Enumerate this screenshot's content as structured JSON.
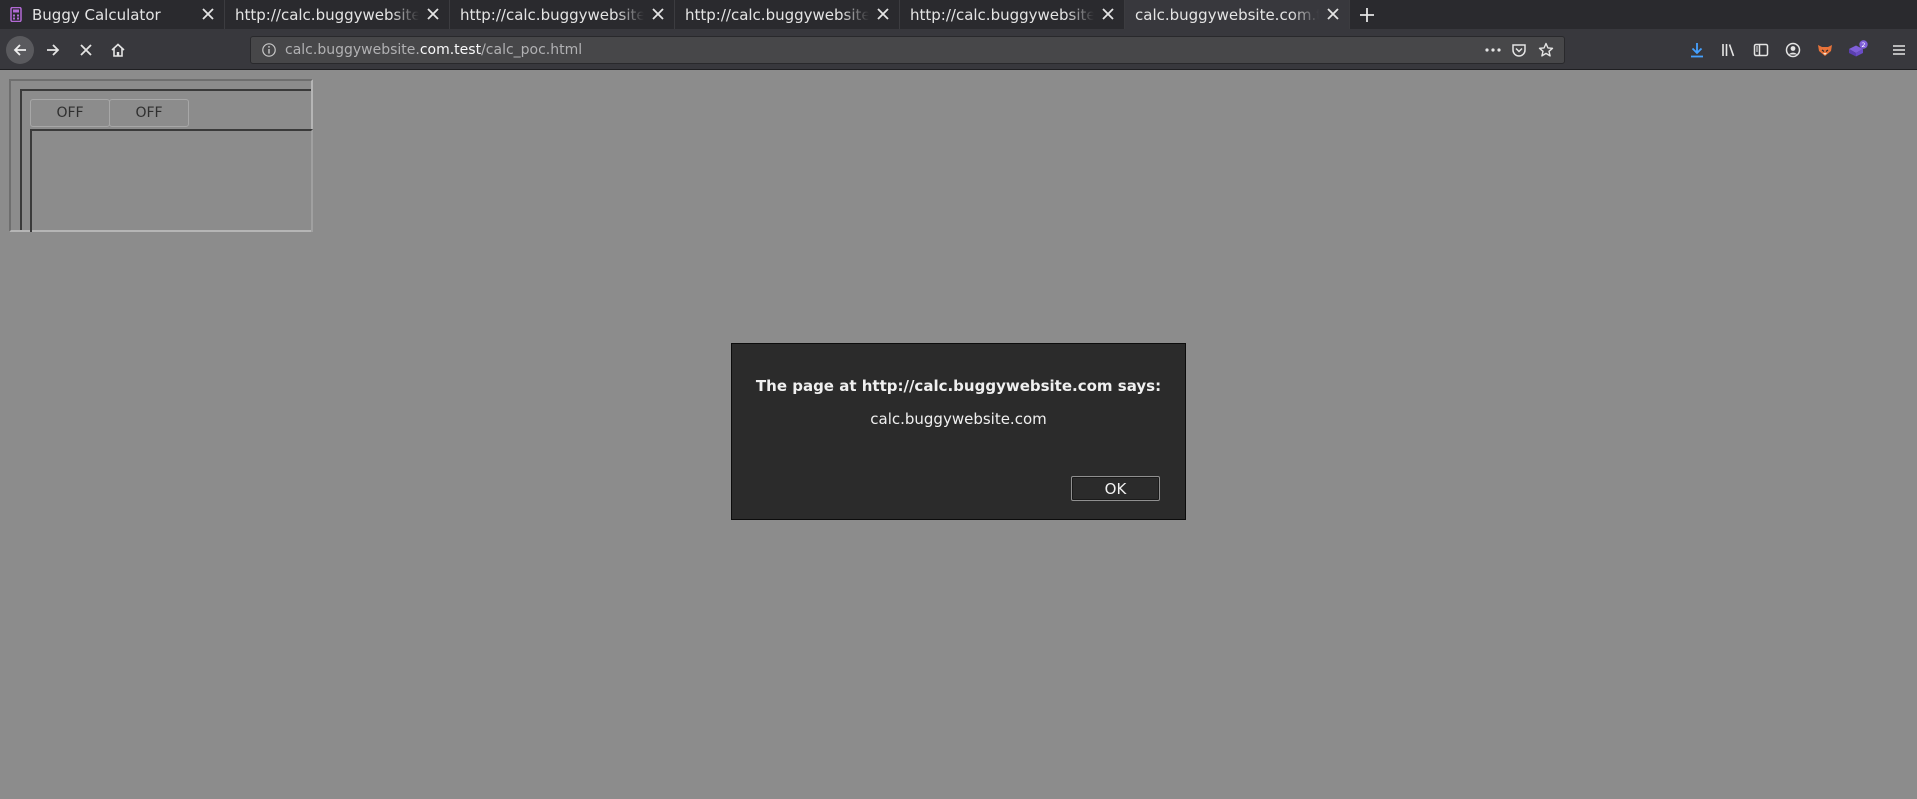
{
  "browser": {
    "tabs": [
      {
        "title": "Buggy Calculator",
        "active": false
      },
      {
        "title": "http://calc.buggywebsite.com",
        "active": false
      },
      {
        "title": "http://calc.buggywebsite.com",
        "active": false
      },
      {
        "title": "http://calc.buggywebsite.com",
        "active": false
      },
      {
        "title": "http://calc.buggywebsite.com",
        "active": false
      },
      {
        "title": "calc.buggywebsite.com.test/calc_poc.html",
        "active": true
      }
    ],
    "url": {
      "prefix": "calc.buggywebsite.",
      "domain": "com.test",
      "path": "/calc_poc.html"
    },
    "extension_badge": "2",
    "colors": {
      "tab_bar": "#2a2a2e",
      "toolbar": "#38383d",
      "urlbar": "#474749",
      "download_accent": "#45a1ff",
      "favicon_accent": "#b36ad6",
      "extension_accent": "#7f5fd9"
    }
  },
  "calculator": {
    "buttons": [
      "OFF",
      "OFF"
    ]
  },
  "alert": {
    "heading": "The page at http://calc.buggywebsite.com says:",
    "message": "calc.buggywebsite.com",
    "ok_label": "OK"
  }
}
